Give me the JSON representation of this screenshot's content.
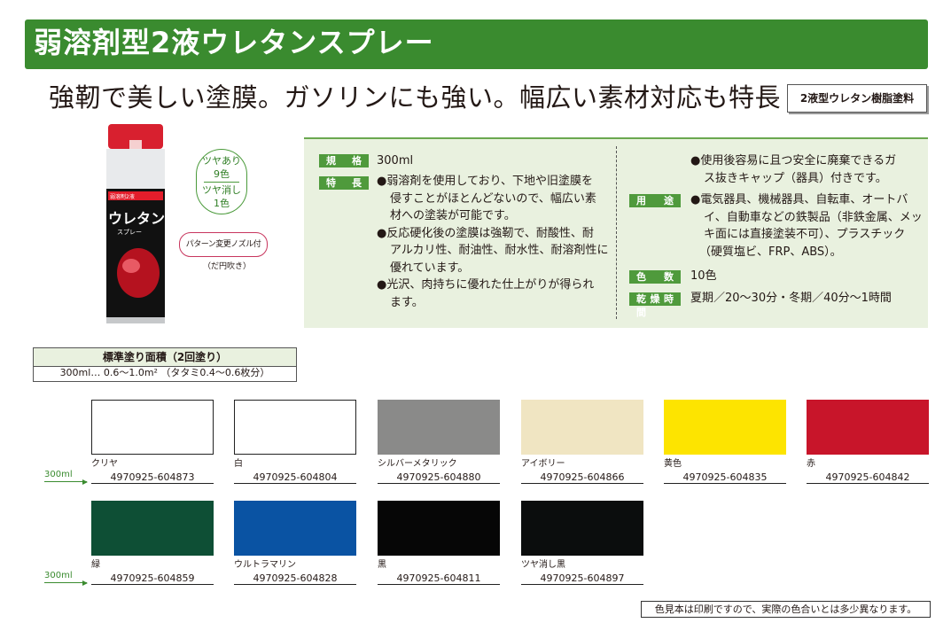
{
  "header": {
    "title": "弱溶剤型2液ウレタンスプレー",
    "tagline": "強靭で美しい塗膜。ガソリンにも強い。幅広い素材対応も特長",
    "type_label": "2液型ウレタン樹脂塗料"
  },
  "product": {
    "can_label_small": "弱溶剤2液",
    "can_label_big": "ウレタン",
    "can_label_sub": "スプレー",
    "gloss_badge": {
      "line1": "ツヤあり",
      "line2": "9色",
      "line3": "ツヤ消し",
      "line4": "1色"
    },
    "nozzle_badge": "パターン変更ノズル付",
    "nozzle_note": "（だ円吹き）"
  },
  "specs": {
    "capacity_label": "規　格",
    "capacity_value": "300ml",
    "features_label": "特　長",
    "features": [
      "●弱溶剤を使用しており、下地や旧塗膜を",
      "侵すことがほとんどないので、幅広い素",
      "材への塗装が可能です。",
      "●反応硬化後の塗膜は強靭で、耐酸性、耐",
      "アルカリ性、耐油性、耐水性、耐溶剤性に",
      "優れています。",
      "●光沢、肉持ちに優れた仕上がりが得られ",
      "ます。"
    ],
    "disposal": [
      "●使用後容易に且つ安全に廃棄できるガ",
      "ス抜きキャップ（器具）付きです。"
    ],
    "use_label": "用　途",
    "use": [
      "●電気器具、機械器具、自転車、オートバ",
      "イ、自動車などの鉄製品（非鉄金属、メッ",
      "キ面には直接塗装不可）、プラスチック",
      "（硬質塩ビ、FRP、ABS）。"
    ],
    "colors_label": "色　数",
    "colors_value": "10色",
    "dry_label": "乾燥時間",
    "dry_value": "夏期／20〜30分・冬期／40分〜1時間"
  },
  "coverage": {
    "heading": "標準塗り面積（2回塗り）",
    "row": "300ml… 0.6〜1.0m² （タタミ0.4〜0.6枚分）"
  },
  "volume_label": "300ml",
  "swatches_row1": [
    {
      "name": "クリヤ",
      "code": "4970925-604873",
      "color": "#ffffff"
    },
    {
      "name": "白",
      "code": "4970925-604804",
      "color": "#ffffff"
    },
    {
      "name": "シルバーメタリック",
      "code": "4970925-604880",
      "color": "#8a8a89"
    },
    {
      "name": "アイボリー",
      "code": "4970925-604866",
      "color": "#f0e5c2"
    },
    {
      "name": "黄色",
      "code": "4970925-604835",
      "color": "#fde400"
    },
    {
      "name": "赤",
      "code": "4970925-604842",
      "color": "#c8152a"
    }
  ],
  "swatches_row2": [
    {
      "name": "緑",
      "code": "4970925-604859",
      "color": "#0e4f35"
    },
    {
      "name": "ウルトラマリン",
      "code": "4970925-604828",
      "color": "#0a53a3"
    },
    {
      "name": "黒",
      "code": "4970925-604811",
      "color": "#060606"
    },
    {
      "name": "ツヤ消し黒",
      "code": "4970925-604897",
      "color": "#0b0d0d"
    }
  ],
  "footnote": "色見本は印刷ですので、実際の色合いとは多少異なります。"
}
